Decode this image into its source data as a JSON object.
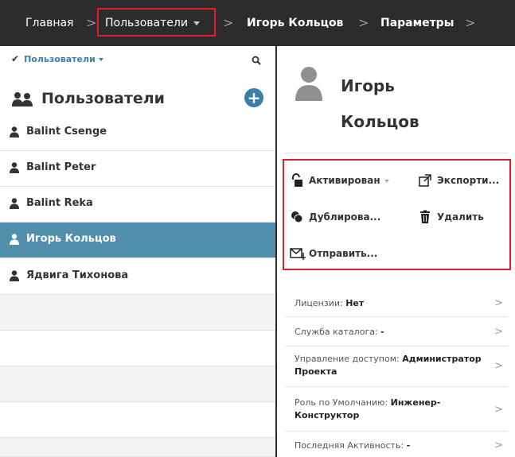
{
  "breadcrumb": {
    "home": "Главная",
    "users": "Пользователи",
    "user": "Игорь Кольцов",
    "settings": "Параметры",
    "separator": ">"
  },
  "left_panel": {
    "filter_label": "Пользователи",
    "title": "Пользователи",
    "add_label": "+",
    "users": [
      {
        "name": "Balint Csenge",
        "selected": false
      },
      {
        "name": "Balint Peter",
        "selected": false
      },
      {
        "name": "Balint Reka",
        "selected": false
      },
      {
        "name": "Игорь Кольцов",
        "selected": true
      },
      {
        "name": "Ядвига Тихонова",
        "selected": false
      }
    ]
  },
  "detail": {
    "name": "Игорь Кольцов",
    "actions": {
      "activated": "Активирован",
      "export": "Экспорти...",
      "duplicate": "Дублирова...",
      "delete": "Удалить",
      "send": "Отправить..."
    },
    "properties": [
      {
        "label": "Лицензии: ",
        "value": "Нет"
      },
      {
        "label": "Служба каталога: ",
        "value": "-"
      },
      {
        "label": "Управление доступом: ",
        "value": "Администратор Проекта"
      },
      {
        "label": "Роль по Умолчанию: ",
        "value": "Инженер-Конструктор"
      },
      {
        "label": "Последняя Активность: ",
        "value": "-"
      }
    ],
    "chevron": ">"
  },
  "colors": {
    "topbar": "#2c2c2c",
    "highlight": "#e01f26",
    "accent": "#3a7fa8",
    "selected_row": "#4f8fac"
  }
}
